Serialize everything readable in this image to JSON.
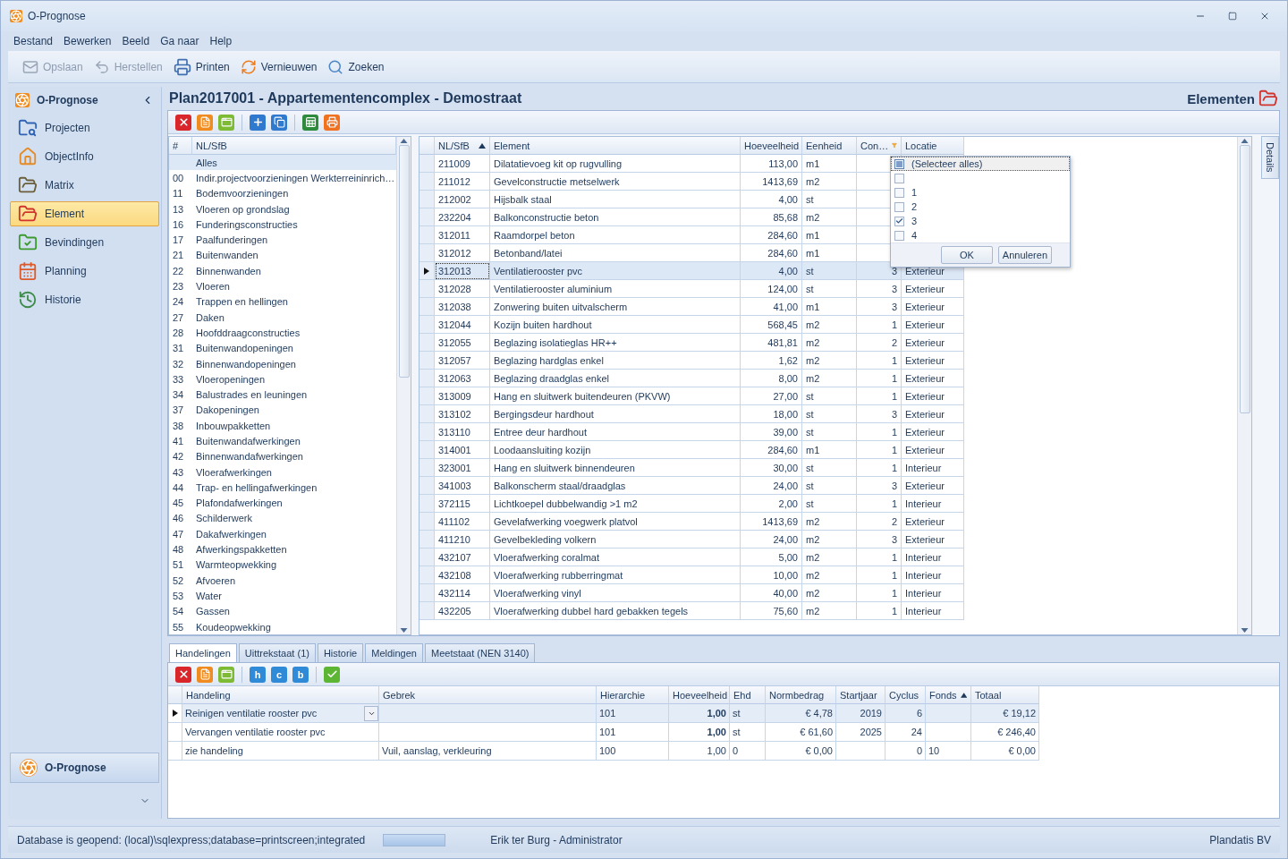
{
  "window": {
    "title": "O-Prognose"
  },
  "menu": [
    "Bestand",
    "Bewerken",
    "Beeld",
    "Ga naar",
    "Help"
  ],
  "toolbar": [
    {
      "label": "Opslaan",
      "kind": "save",
      "disabled": true
    },
    {
      "label": "Herstellen",
      "kind": "undo",
      "disabled": true
    },
    {
      "label": "Printen",
      "kind": "print",
      "disabled": false
    },
    {
      "label": "Vernieuwen",
      "kind": "refresh",
      "disabled": false
    },
    {
      "label": "Zoeken",
      "kind": "search",
      "disabled": false
    }
  ],
  "sidebar": {
    "title": "O-Prognose",
    "footer": "O-Prognose",
    "items": [
      {
        "label": "Projecten",
        "kind": "projects",
        "selected": false
      },
      {
        "label": "ObjectInfo",
        "kind": "house",
        "selected": false
      },
      {
        "label": "Matrix",
        "kind": "matrix",
        "selected": false
      },
      {
        "label": "Element",
        "kind": "element",
        "selected": true
      },
      {
        "label": "Bevindingen",
        "kind": "findings",
        "selected": false
      },
      {
        "label": "Planning",
        "kind": "planning",
        "selected": false
      },
      {
        "label": "Historie",
        "kind": "history",
        "selected": false
      }
    ]
  },
  "content": {
    "title": "Plan2017001 - Appartementencomplex - Demostraat",
    "section": "Elementen"
  },
  "grid_toolbar": [
    {
      "kind": "delete"
    },
    {
      "kind": "list"
    },
    {
      "kind": "window"
    },
    {
      "kind": "add"
    },
    {
      "kind": "copy"
    },
    {
      "kind": "excel"
    },
    {
      "kind": "print"
    }
  ],
  "category_list": {
    "columns": [
      "#",
      "NL/SfB"
    ],
    "rows": [
      {
        "name": "Alles",
        "selected": true
      },
      {
        "code": "00",
        "name": "Indir.projectvoorzieningen Werkterreininrich…",
        "selected": false
      },
      {
        "code": "11",
        "name": "Bodemvoorzieningen",
        "selected": false
      },
      {
        "code": "13",
        "name": "Vloeren op grondslag",
        "selected": false
      },
      {
        "code": "16",
        "name": "Funderingsconstructies",
        "selected": false
      },
      {
        "code": "17",
        "name": "Paalfunderingen",
        "selected": false
      },
      {
        "code": "21",
        "name": "Buitenwanden",
        "selected": false
      },
      {
        "code": "22",
        "name": "Binnenwanden",
        "selected": false
      },
      {
        "code": "23",
        "name": "Vloeren",
        "selected": false
      },
      {
        "code": "24",
        "name": "Trappen en hellingen",
        "selected": false
      },
      {
        "code": "27",
        "name": "Daken",
        "selected": false
      },
      {
        "code": "28",
        "name": "Hoofddraagconstructies",
        "selected": false
      },
      {
        "code": "31",
        "name": "Buitenwandopeningen",
        "selected": false
      },
      {
        "code": "32",
        "name": "Binnenwandopeningen",
        "selected": false
      },
      {
        "code": "33",
        "name": "Vloeropeningen",
        "selected": false
      },
      {
        "code": "34",
        "name": "Balustrades en leuningen",
        "selected": false
      },
      {
        "code": "37",
        "name": "Dakopeningen",
        "selected": false
      },
      {
        "code": "38",
        "name": "Inbouwpakketten",
        "selected": false
      },
      {
        "code": "41",
        "name": "Buitenwandafwerkingen",
        "selected": false
      },
      {
        "code": "42",
        "name": "Binnenwandafwerkingen",
        "selected": false
      },
      {
        "code": "43",
        "name": "Vloerafwerkingen",
        "selected": false
      },
      {
        "code": "44",
        "name": "Trap- en hellingafwerkingen",
        "selected": false
      },
      {
        "code": "45",
        "name": "Plafondafwerkingen",
        "selected": false
      },
      {
        "code": "46",
        "name": "Schilderwerk",
        "selected": false
      },
      {
        "code": "47",
        "name": "Dakafwerkingen",
        "selected": false
      },
      {
        "code": "48",
        "name": "Afwerkingspakketten",
        "selected": false
      },
      {
        "code": "51",
        "name": "Warmteopwekking",
        "selected": false
      },
      {
        "code": "52",
        "name": "Afvoeren",
        "selected": false
      },
      {
        "code": "53",
        "name": "Water",
        "selected": false
      },
      {
        "code": "54",
        "name": "Gassen",
        "selected": false
      },
      {
        "code": "55",
        "name": "Koudeopwekking",
        "selected": false
      }
    ]
  },
  "elements": {
    "columns": [
      {
        "label": "NL/SfB",
        "sorted_ascending": true
      },
      {
        "label": "Element"
      },
      {
        "label": "Hoeveelheid"
      },
      {
        "label": "Eenheid"
      },
      {
        "label": "Con…",
        "filtered": true
      },
      {
        "label": "Locatie"
      }
    ],
    "rows": [
      {
        "code": "211009",
        "element": "Dilatatievoeg kit op rugvulling",
        "qty": "113,00",
        "unit": "m1",
        "selected": false
      },
      {
        "code": "211012",
        "element": "Gevelconstructie metselwerk",
        "qty": "1413,69",
        "unit": "m2",
        "selected": false
      },
      {
        "code": "212002",
        "element": "Hijsbalk staal",
        "qty": "4,00",
        "unit": "st",
        "selected": false
      },
      {
        "code": "232204",
        "element": "Balkonconstructie beton",
        "qty": "85,68",
        "unit": "m2",
        "selected": false
      },
      {
        "code": "312011",
        "element": "Raamdorpel beton",
        "qty": "284,60",
        "unit": "m1",
        "selected": false
      },
      {
        "code": "312012",
        "element": "Betonband/latei",
        "qty": "284,60",
        "unit": "m1",
        "selected": false
      },
      {
        "code": "312013",
        "element": "Ventilatierooster pvc",
        "qty": "4,00",
        "unit": "st",
        "con": "3",
        "location": "Exterieur",
        "selected": true
      },
      {
        "code": "312028",
        "element": "Ventilatierooster aluminium",
        "qty": "124,00",
        "unit": "st",
        "con": "3",
        "location": "Exterieur",
        "selected": false
      },
      {
        "code": "312038",
        "element": "Zonwering buiten uitvalscherm",
        "qty": "41,00",
        "unit": "m1",
        "con": "3",
        "location": "Exterieur",
        "selected": false
      },
      {
        "code": "312044",
        "element": "Kozijn buiten hardhout",
        "qty": "568,45",
        "unit": "m2",
        "con": "1",
        "location": "Exterieur",
        "selected": false
      },
      {
        "code": "312055",
        "element": "Beglazing isolatieglas HR++",
        "qty": "481,81",
        "unit": "m2",
        "con": "2",
        "location": "Exterieur",
        "selected": false
      },
      {
        "code": "312057",
        "element": "Beglazing hardglas enkel",
        "qty": "1,62",
        "unit": "m2",
        "con": "1",
        "location": "Exterieur",
        "selected": false
      },
      {
        "code": "312063",
        "element": "Beglazing draadglas enkel",
        "qty": "8,00",
        "unit": "m2",
        "con": "1",
        "location": "Exterieur",
        "selected": false
      },
      {
        "code": "313009",
        "element": "Hang en sluitwerk buitendeuren (PKVW)",
        "qty": "27,00",
        "unit": "st",
        "con": "1",
        "location": "Exterieur",
        "selected": false
      },
      {
        "code": "313102",
        "element": "Bergingsdeur hardhout",
        "qty": "18,00",
        "unit": "st",
        "con": "3",
        "location": "Exterieur",
        "selected": false
      },
      {
        "code": "313110",
        "element": "Entree deur hardhout",
        "qty": "39,00",
        "unit": "st",
        "con": "1",
        "location": "Exterieur",
        "selected": false
      },
      {
        "code": "314001",
        "element": "Loodaansluiting kozijn",
        "qty": "284,60",
        "unit": "m1",
        "con": "1",
        "location": "Exterieur",
        "selected": false
      },
      {
        "code": "323001",
        "element": "Hang en sluitwerk binnendeuren",
        "qty": "30,00",
        "unit": "st",
        "con": "1",
        "location": "Interieur",
        "selected": false
      },
      {
        "code": "341003",
        "element": "Balkonscherm staal/draadglas",
        "qty": "24,00",
        "unit": "st",
        "con": "3",
        "location": "Exterieur",
        "selected": false
      },
      {
        "code": "372115",
        "element": "Lichtkoepel dubbelwandig >1 m2",
        "qty": "2,00",
        "unit": "st",
        "con": "1",
        "location": "Interieur",
        "selected": false
      },
      {
        "code": "411102",
        "element": "Gevelafwerking voegwerk platvol",
        "qty": "1413,69",
        "unit": "m2",
        "con": "2",
        "location": "Exterieur",
        "selected": false
      },
      {
        "code": "411210",
        "element": "Gevelbekleding volkern",
        "qty": "24,00",
        "unit": "m2",
        "con": "3",
        "location": "Exterieur",
        "selected": false
      },
      {
        "code": "432107",
        "element": "Vloerafwerking coralmat",
        "qty": "5,00",
        "unit": "m2",
        "con": "1",
        "location": "Interieur",
        "selected": false
      },
      {
        "code": "432108",
        "element": "Vloerafwerking rubberringmat",
        "qty": "10,00",
        "unit": "m2",
        "con": "1",
        "location": "Interieur",
        "selected": false
      },
      {
        "code": "432114",
        "element": "Vloerafwerking vinyl",
        "qty": "40,00",
        "unit": "m2",
        "con": "1",
        "location": "Interieur",
        "selected": false
      },
      {
        "code": "432205",
        "element": "Vloerafwerking dubbel hard gebakken tegels",
        "qty": "75,60",
        "unit": "m2",
        "con": "1",
        "location": "Interieur",
        "selected": false
      }
    ]
  },
  "filter_popup": {
    "options": [
      {
        "label": "(Selecteer alles)",
        "checked": false,
        "indeterminate": true,
        "selected": true
      },
      {
        "checked": false,
        "indeterminate": false,
        "selected": false
      },
      {
        "label": "1",
        "checked": false,
        "indeterminate": false,
        "selected": false
      },
      {
        "label": "2",
        "checked": false,
        "indeterminate": false,
        "selected": false
      },
      {
        "label": "3",
        "checked": true,
        "indeterminate": false,
        "selected": false
      },
      {
        "label": "4",
        "checked": false,
        "indeterminate": false,
        "selected": false
      }
    ],
    "buttons": [
      "OK",
      "Annuleren"
    ]
  },
  "side_tab": "Details",
  "bottom_tabs": [
    {
      "label": "Handelingen",
      "selected": true
    },
    {
      "label": "Uittrekstaat (1)",
      "selected": false
    },
    {
      "label": "Historie",
      "selected": false
    },
    {
      "label": "Meldingen",
      "selected": false
    },
    {
      "label": "Meetstaat (NEN 3140)",
      "selected": false
    }
  ],
  "bottom_toolbar": [
    {
      "kind": "delete"
    },
    {
      "kind": "list"
    },
    {
      "kind": "window"
    },
    {
      "kind": "letter",
      "label": "h"
    },
    {
      "kind": "letter",
      "label": "c"
    },
    {
      "kind": "letter",
      "label": "b"
    },
    {
      "kind": "check"
    }
  ],
  "actions": {
    "columns": [
      {
        "label": "Handeling"
      },
      {
        "label": "Gebrek"
      },
      {
        "label": "Hierarchie"
      },
      {
        "label": "Hoeveelheid"
      },
      {
        "label": "Ehd"
      },
      {
        "label": "Normbedrag"
      },
      {
        "label": "Startjaar"
      },
      {
        "label": "Cyclus"
      },
      {
        "label": "Fonds",
        "sorted_ascending": true
      },
      {
        "label": "Totaal"
      }
    ],
    "rows": [
      {
        "cells": [
          "Reinigen ventilatie rooster pvc",
          null,
          "101",
          "1,00",
          "st",
          "€ 4,78",
          "2019",
          "6",
          null,
          "€ 19,12"
        ],
        "selected": true,
        "bold_quantity": true
      },
      {
        "cells": [
          "Vervangen ventilatie rooster pvc",
          null,
          "101",
          "1,00",
          "st",
          "€ 61,60",
          "2025",
          "24",
          null,
          "€ 246,40"
        ],
        "selected": false,
        "bold_quantity": true
      },
      {
        "cells": [
          "zie handeling",
          "Vuil, aanslag, verkleuring",
          "100",
          "1,00",
          "0",
          "€ 0,00",
          null,
          "0",
          "10",
          "€ 0,00"
        ],
        "selected": false,
        "bold_quantity": false
      }
    ]
  },
  "status_bar": {
    "text": "Database is geopend: (local)\\sqlexpress;database=printscreen;integrated",
    "progress": {
      "level": 1
    },
    "user": "Erik ter Burg - Administrator",
    "company": "Plandatis BV"
  }
}
